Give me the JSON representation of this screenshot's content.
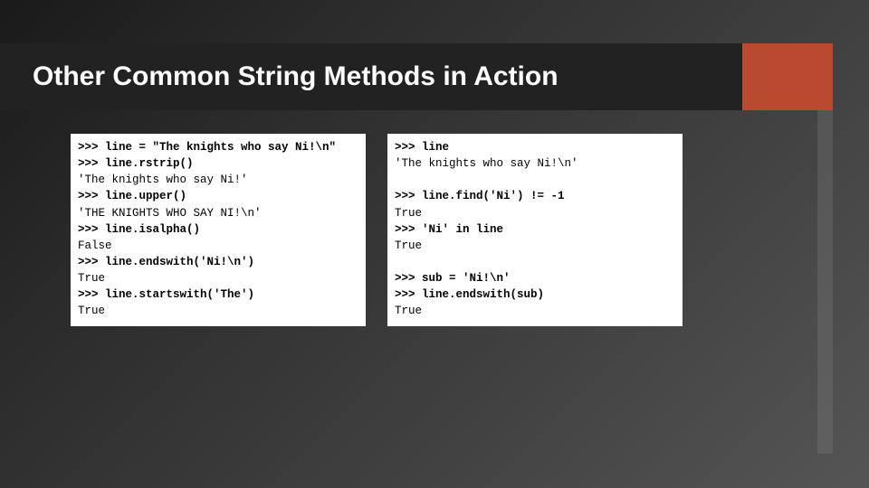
{
  "title": "Other Common String Methods in Action",
  "left_code": [
    {
      "t": ">>> line = \"The knights who say Ni!\\n\"",
      "b": true
    },
    {
      "t": ">>> line.rstrip()",
      "b": true
    },
    {
      "t": "'The knights who say Ni!'",
      "b": false
    },
    {
      "t": ">>> line.upper()",
      "b": true
    },
    {
      "t": "'THE KNIGHTS WHO SAY NI!\\n'",
      "b": false
    },
    {
      "t": ">>> line.isalpha()",
      "b": true
    },
    {
      "t": "False",
      "b": false
    },
    {
      "t": ">>> line.endswith('Ni!\\n')",
      "b": true
    },
    {
      "t": "True",
      "b": false
    },
    {
      "t": ">>> line.startswith('The')",
      "b": true
    },
    {
      "t": "True",
      "b": false
    }
  ],
  "right_code": [
    {
      "t": ">>> line",
      "b": true
    },
    {
      "t": "'The knights who say Ni!\\n'",
      "b": false
    },
    {
      "t": "",
      "b": false
    },
    {
      "t": ">>> line.find('Ni') != -1",
      "b": true
    },
    {
      "t": "True",
      "b": false
    },
    {
      "t": ">>> 'Ni' in line",
      "b": true
    },
    {
      "t": "True",
      "b": false
    },
    {
      "t": "",
      "b": false
    },
    {
      "t": ">>> sub = 'Ni!\\n'",
      "b": true
    },
    {
      "t": ">>> line.endswith(sub)",
      "b": true
    },
    {
      "t": "True",
      "b": false
    }
  ]
}
